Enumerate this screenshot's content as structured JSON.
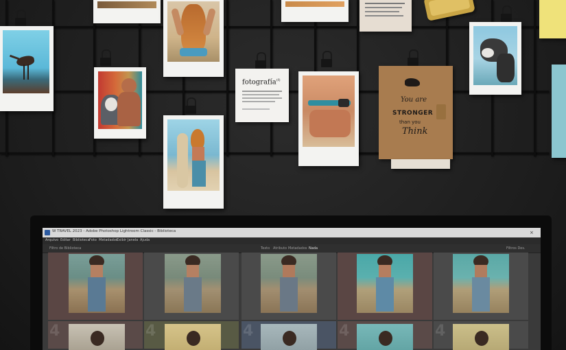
{
  "scene": {
    "description_tags": [
      "moodboard-wall",
      "grid-panel",
      "polaroid-photos",
      "binder-clips",
      "computer-monitor",
      "photo-editing-software"
    ]
  },
  "notes": {
    "fotografia_title": "fotografía",
    "fotografia_sup": "(f)",
    "kraft_line1": "You are",
    "kraft_line2": "STRONGER",
    "kraft_line3": "than you",
    "kraft_line4": "Think"
  },
  "app": {
    "window_title": "W TRAVEL 2023 - Adobe Photoshop Lightroom Classic - Biblioteca",
    "menu": [
      "Arquivo",
      "Editar",
      "Biblioteca",
      "Foto",
      "Metadados",
      "Exibir",
      "Janela",
      "Ajuda"
    ],
    "filter_label": "Filtro de Biblioteca",
    "filter_tabs": [
      "Texto",
      "Atributo",
      "Metadados",
      "Nada"
    ],
    "filter_right": "Filtros Des."
  },
  "grid": {
    "row2_numbers": [
      "4",
      "4",
      "4",
      "4",
      "4"
    ]
  },
  "colors": {
    "wall": "#1f1f1f",
    "grid_wire": "#0e0e0e",
    "polaroid": "#f3f3f1",
    "kraft": "#a87c4f",
    "sticky_yellow": "#efe27a",
    "sticky_blue": "#8cc6cf",
    "lr_panel": "#3a3a3a",
    "cell_warm": "#5a4644",
    "cell_green": "#4a5244",
    "cell_neutral": "#4a4a4a"
  }
}
